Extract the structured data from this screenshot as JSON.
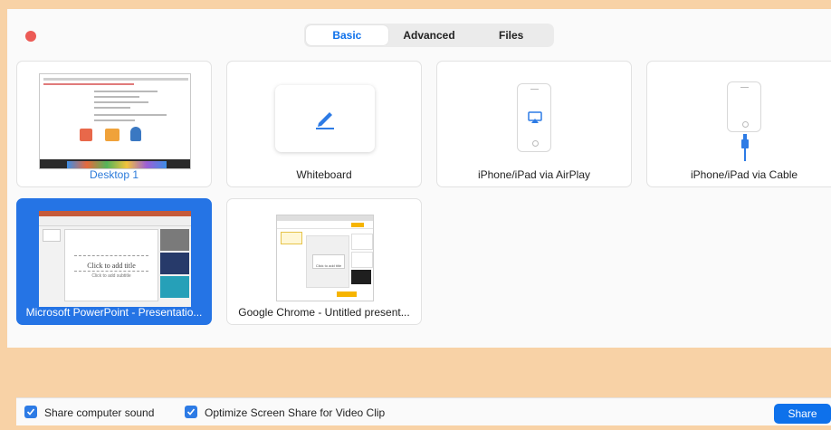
{
  "tabs": [
    {
      "label": "Basic",
      "active": true
    },
    {
      "label": "Advanced",
      "active": false
    },
    {
      "label": "Files",
      "active": false
    }
  ],
  "sources": [
    {
      "label": "Desktop 1",
      "thumbnail": "desktop-screenshot"
    },
    {
      "label": "Whiteboard",
      "icon": "pencil-icon"
    },
    {
      "label": "iPhone/iPad via AirPlay",
      "icon": "airplay-icon"
    },
    {
      "label": "iPhone/iPad via Cable",
      "icon": "cable-icon"
    },
    {
      "label": "Microsoft PowerPoint - Presentatio...",
      "selected": true,
      "thumbnail": "powerpoint-window"
    },
    {
      "label": "Google Chrome - Untitled present...",
      "thumbnail": "chrome-window"
    }
  ],
  "thumbnails": {
    "powerpoint_slide_title": "Click to add title",
    "powerpoint_slide_subtitle": "Click to add subtitle",
    "chrome_slide_title": "Click to add title"
  },
  "options": [
    {
      "label": "Share computer sound",
      "checked": true
    },
    {
      "label": "Optimize Screen Share for Video Clip",
      "checked": true
    }
  ],
  "share_button": "Share",
  "colors": {
    "accent": "#0e71eb",
    "selected_tile": "#2574e5",
    "close_dot": "#ec5b56",
    "frame": "#f8d2a6"
  }
}
